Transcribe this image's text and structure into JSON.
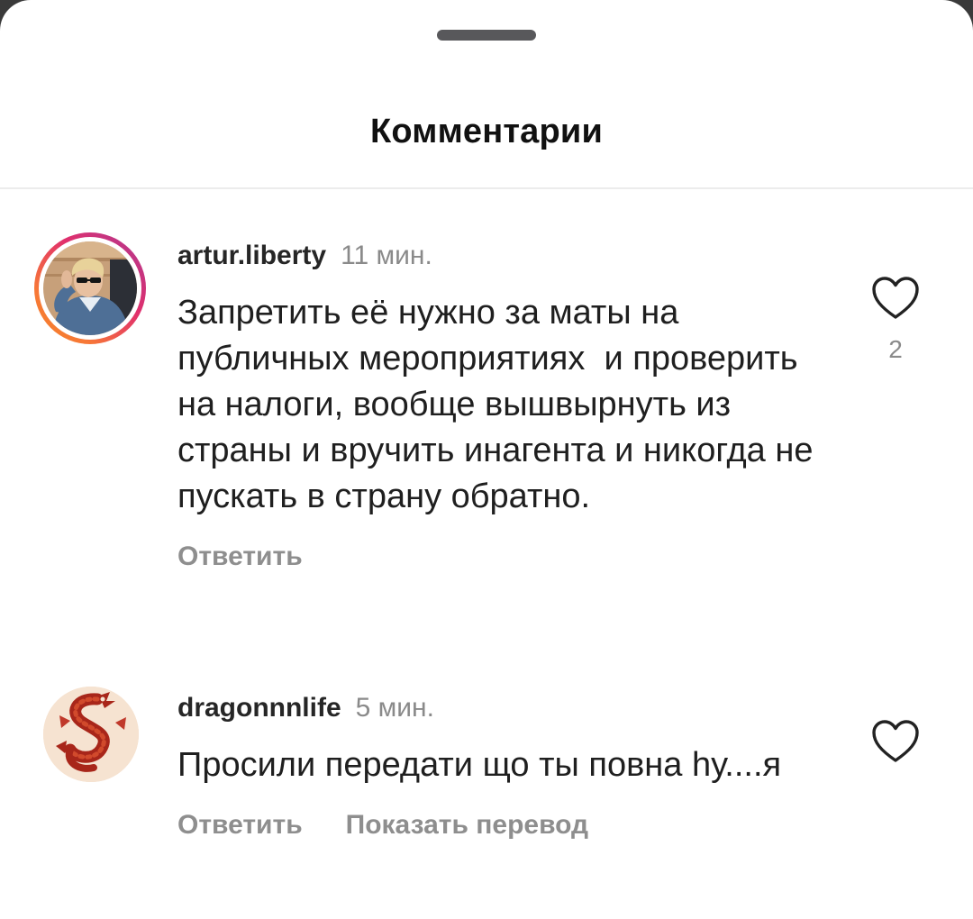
{
  "sheet": {
    "title": "Комментарии"
  },
  "comments": [
    {
      "username": "artur.liberty",
      "time": "11 мин.",
      "text": "Запретить её нужно за маты на публичных мероприятиях  и проверить на налоги, вообще вышвырнуть из страны и вручить инагента и никогда не пускать в страну обратно.",
      "likes": "2",
      "actions": [
        "Ответить"
      ],
      "avatar_icon": "user-photo-avatar",
      "has_story_ring": true
    },
    {
      "username": "dragonnnlife",
      "time": "5 мин.",
      "text": "Просили передати що ты повна hу....я",
      "likes": "",
      "actions": [
        "Ответить",
        "Показать перевод"
      ],
      "avatar_icon": "dragon-avatar",
      "has_story_ring": false
    }
  ],
  "icons": {
    "like": "heart-outline-icon"
  },
  "colors": {
    "background": "#ffffff",
    "text_primary": "#1f1f1f",
    "text_secondary": "#8e8e8e",
    "story_ring_start": "#f58529",
    "story_ring_end": "#a02aa8",
    "grabber": "#58585b"
  }
}
